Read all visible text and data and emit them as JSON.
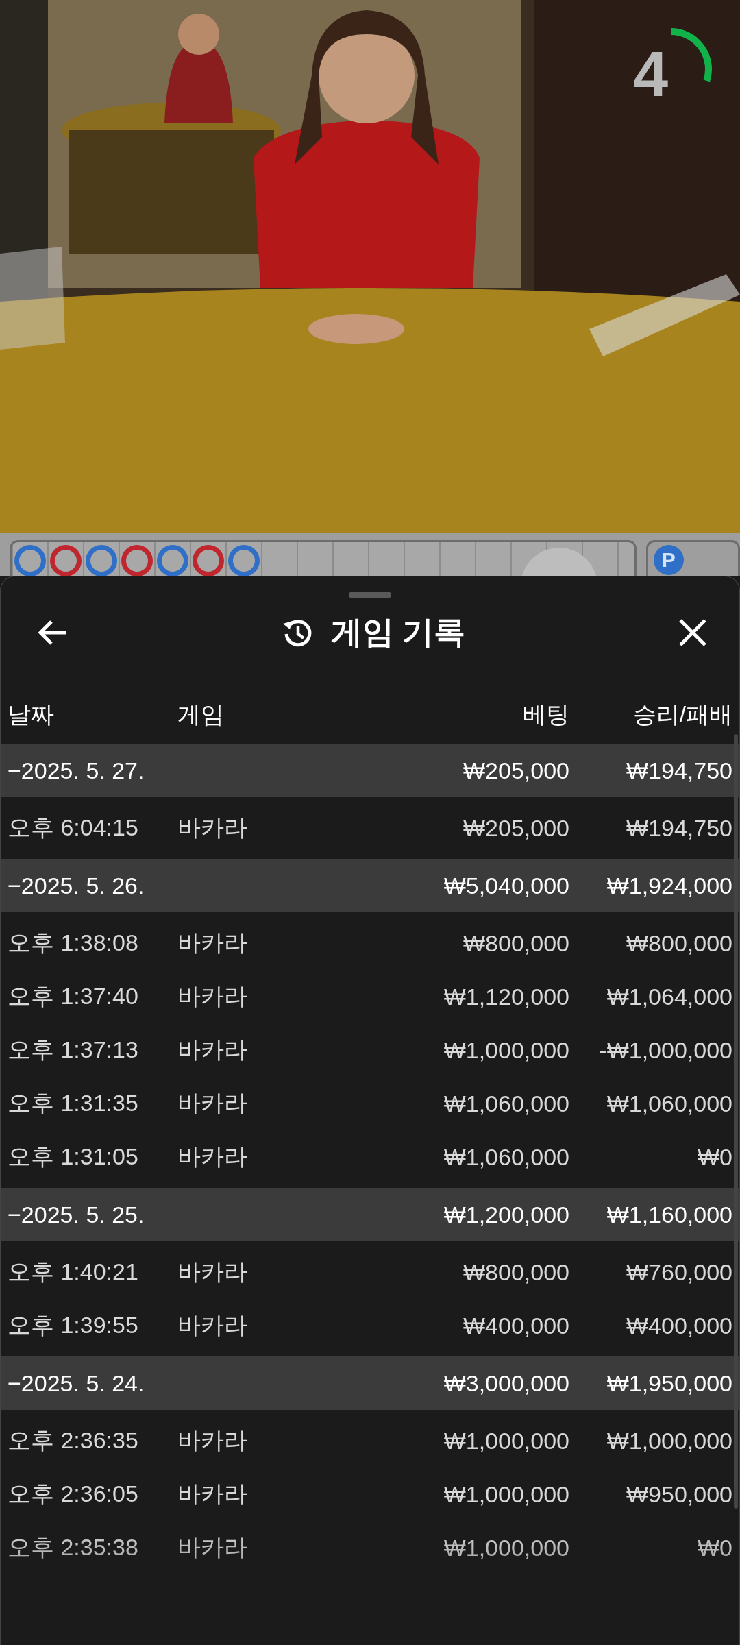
{
  "video": {
    "kind": "picture",
    "countdown": "4"
  },
  "road": {
    "beads": [
      {
        "color": "#2f6fc7"
      },
      {
        "color": "#c0262d"
      },
      {
        "color": "#2f6fc7"
      },
      {
        "color": "#c0262d"
      },
      {
        "color": "#2f6fc7"
      },
      {
        "color": "#c0262d"
      },
      {
        "color": "#2f6fc7"
      }
    ],
    "side_badge": "P"
  },
  "sheet": {
    "title": "게임 기록",
    "columns": [
      "날짜",
      "게임",
      "베팅",
      "승리/패배"
    ],
    "groups": [
      {
        "date": "−2025. 5. 27.",
        "bet": "₩205,000",
        "result": "₩194,750",
        "rows": [
          {
            "time": "오후 6:04:15",
            "game": "바카라",
            "bet": "₩205,000",
            "result": "₩194,750"
          }
        ]
      },
      {
        "date": "−2025. 5. 26.",
        "bet": "₩5,040,000",
        "result": "₩1,924,000",
        "rows": [
          {
            "time": "오후 1:38:08",
            "game": "바카라",
            "bet": "₩800,000",
            "result": "₩800,000"
          },
          {
            "time": "오후 1:37:40",
            "game": "바카라",
            "bet": "₩1,120,000",
            "result": "₩1,064,000"
          },
          {
            "time": "오후 1:37:13",
            "game": "바카라",
            "bet": "₩1,000,000",
            "result": "-₩1,000,000"
          },
          {
            "time": "오후 1:31:35",
            "game": "바카라",
            "bet": "₩1,060,000",
            "result": "₩1,060,000"
          },
          {
            "time": "오후 1:31:05",
            "game": "바카라",
            "bet": "₩1,060,000",
            "result": "₩0"
          }
        ]
      },
      {
        "date": "−2025. 5. 25.",
        "bet": "₩1,200,000",
        "result": "₩1,160,000",
        "rows": [
          {
            "time": "오후 1:40:21",
            "game": "바카라",
            "bet": "₩800,000",
            "result": "₩760,000"
          },
          {
            "time": "오후 1:39:55",
            "game": "바카라",
            "bet": "₩400,000",
            "result": "₩400,000"
          }
        ]
      },
      {
        "date": "−2025. 5. 24.",
        "bet": "₩3,000,000",
        "result": "₩1,950,000",
        "rows": [
          {
            "time": "오후 2:36:35",
            "game": "바카라",
            "bet": "₩1,000,000",
            "result": "₩1,000,000"
          },
          {
            "time": "오후 2:36:05",
            "game": "바카라",
            "bet": "₩1,000,000",
            "result": "₩950,000"
          },
          {
            "time": "오후 2:35:38",
            "game": "바카라",
            "bet": "₩1,000,000",
            "result": "₩0"
          }
        ]
      }
    ]
  }
}
